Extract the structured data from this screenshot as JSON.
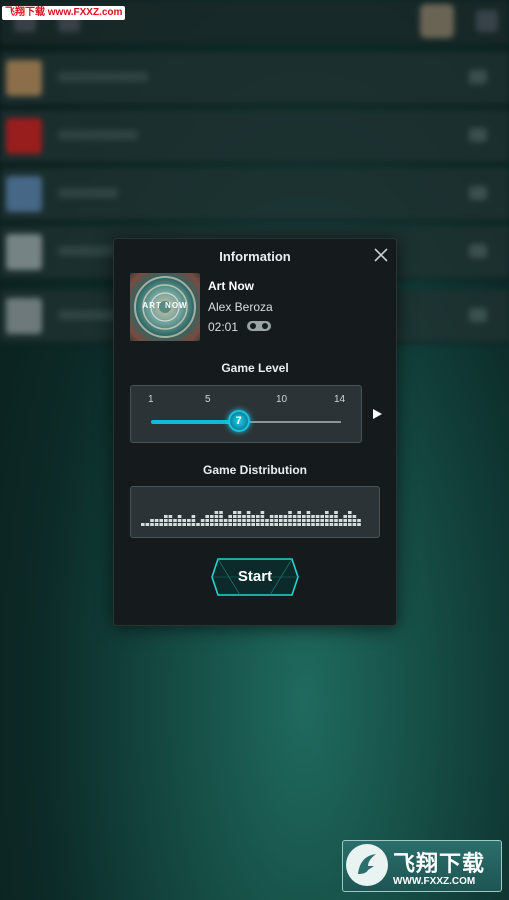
{
  "watermark_top": "飞翔下载 www.FXXZ.com",
  "dialog": {
    "title": "Information",
    "song": {
      "cover_text": "ART NOW",
      "title": "Art Now",
      "artist": "Alex Beroza",
      "duration": "02:01"
    },
    "level": {
      "label": "Game Level",
      "ticks": [
        "1",
        "5",
        "10",
        "14"
      ],
      "value": 7,
      "min": 1,
      "max": 14
    },
    "distribution": {
      "label": "Game Distribution",
      "bars": [
        1,
        1,
        2,
        2,
        2,
        3,
        3,
        2,
        3,
        2,
        2,
        3,
        1,
        2,
        3,
        3,
        4,
        4,
        2,
        3,
        4,
        4,
        3,
        4,
        3,
        3,
        4,
        2,
        3,
        3,
        3,
        3,
        4,
        3,
        4,
        3,
        4,
        3,
        3,
        3,
        4,
        3,
        4,
        2,
        3,
        4,
        3,
        2
      ]
    },
    "start_label": "Start"
  },
  "watermark_bottom": {
    "name": "飞翔下载",
    "url": "WWW.FXXZ.COM"
  },
  "colors": {
    "accent": "#17b8d6",
    "dialog_bg": "#151b1d",
    "panel_bg": "#2b3336"
  }
}
